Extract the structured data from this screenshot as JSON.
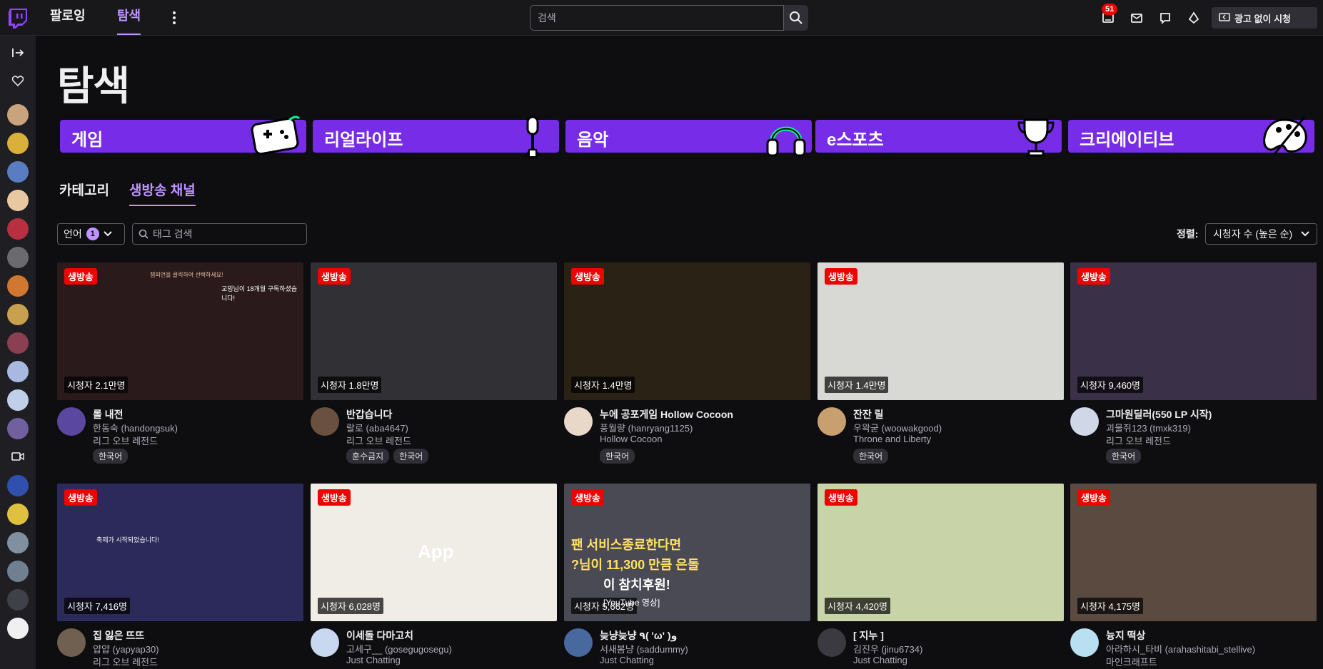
{
  "nav": {
    "following": "팔로잉",
    "browse": "탐색",
    "search_placeholder": "검색",
    "notification_count": "51",
    "ad_free": "광고 없이 시청"
  },
  "page": {
    "title": "탐색"
  },
  "categories": [
    "게임",
    "리얼라이프",
    "음악",
    "e스포츠",
    "크리에이티브"
  ],
  "tabs": [
    "카테고리",
    "생방송 채널"
  ],
  "filters": {
    "language_label": "언어",
    "language_count": "1",
    "tag_search_placeholder": "태그 검색",
    "sort_label": "정렬:",
    "sort_value": "시청자 수 (높은 순)"
  },
  "live_label": "생방송",
  "streams": [
    {
      "viewers": "시청자 2.1만명",
      "title": "롤 내전",
      "channel": "한동숙 (handongsuk)",
      "game": "리그 오브 레전드",
      "tags": [
        "한국어"
      ],
      "thumb_color": "#2a1a1c"
    },
    {
      "viewers": "시청자 1.8만명",
      "title": "반갑습니다",
      "channel": "랄로 (aba4647)",
      "game": "리그 오브 레전드",
      "tags": [
        "훈수금지",
        "한국어"
      ],
      "thumb_color": "#303035"
    },
    {
      "viewers": "시청자 1.4만명",
      "title": "누에 공포게임 Hollow Cocoon",
      "channel": "풍월량 (hanryang1125)",
      "game": "Hollow Cocoon",
      "tags": [
        "한국어"
      ],
      "thumb_color": "#2b2216"
    },
    {
      "viewers": "시청자 1.4만명",
      "title": "잔잔 릴",
      "channel": "우왁굳 (woowakgood)",
      "game": "Throne and Liberty",
      "tags": [
        "한국어"
      ],
      "thumb_color": "#d8d8d4"
    },
    {
      "viewers": "시청자 9,460명",
      "title": "그마원딜러(550 LP 시작)",
      "channel": "괴물쥐123 (tmxk319)",
      "game": "리그 오브 레전드",
      "tags": [
        "한국어"
      ],
      "thumb_color": "#3a3148"
    },
    {
      "viewers": "시청자 7,416명",
      "title": "집 잃은 뜨뜨",
      "channel": "얍얍 (yapyap30)",
      "game": "리그 오브 레전드",
      "tags": [],
      "thumb_color": "#2c2a5a"
    },
    {
      "viewers": "시청자 6,028명",
      "title": "이세돌 다마고치",
      "channel": "고세구__ (gosegugosegu)",
      "game": "Just Chatting",
      "tags": [],
      "thumb_color": "#f0ece6"
    },
    {
      "viewers": "시청자 5,662명",
      "title": "늦냥늦냥 ٩( 'ω' )و",
      "channel": "서새봄냥 (saddummy)",
      "game": "Just Chatting",
      "tags": [],
      "thumb_color": "#4a4a55"
    },
    {
      "viewers": "시청자 4,420명",
      "title": "[ 지누 ]",
      "channel": "김진우 (jinu6734)",
      "game": "Just Chatting",
      "tags": [],
      "thumb_color": "#c8d4a8"
    },
    {
      "viewers": "시청자 4,175명",
      "title": "늉지 떡상",
      "channel": "아라하시_타비 (arahashitabi_stellive)",
      "game": "마인크래프트",
      "tags": [],
      "thumb_color": "#5a4a40"
    }
  ],
  "thumb_overlays": {
    "s1_top": "챔피언을 클릭하여 선택하세요!",
    "s1_sub": "교밍님이 18개월 구독하셨습니다!",
    "s6_sub": "축제가 시작되었습니다!",
    "s7_app": "App",
    "s8_fan": "팬 서비스종료한다면",
    "s8_amount": "?님이 11,300 만큼 은돌",
    "s8_support": "이 참치후원!",
    "s8_video": "[YouTube 영상]"
  }
}
